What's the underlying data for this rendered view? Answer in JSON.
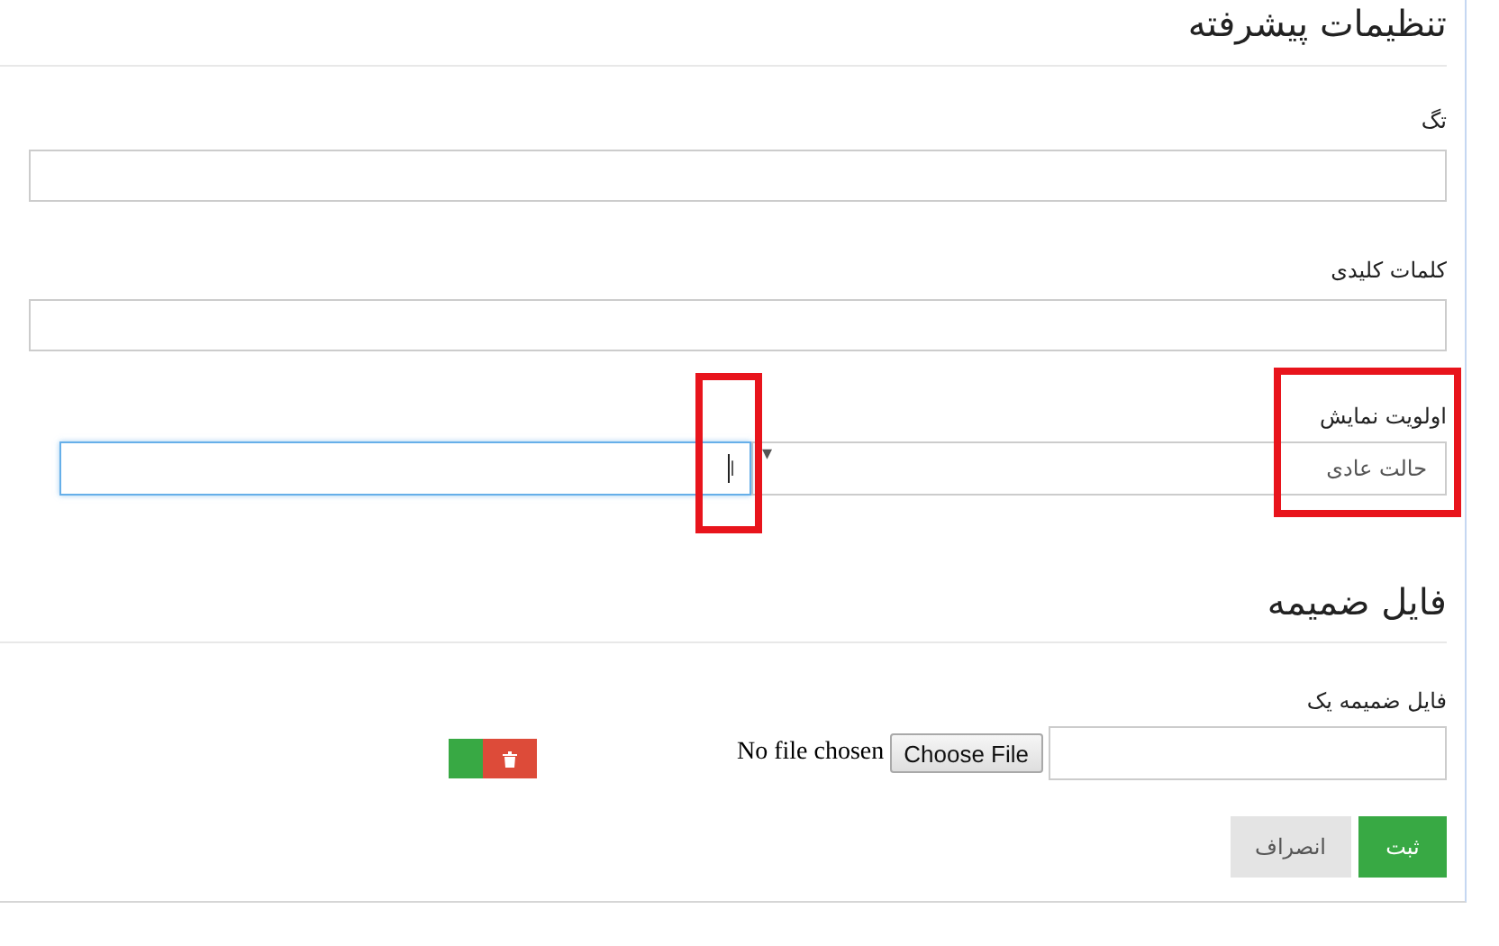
{
  "advanced_settings": {
    "title": "تنظیمات پیشرفته",
    "fields": [
      {
        "label": "تگ"
      },
      {
        "label": "کلمات کلیدی"
      }
    ],
    "priority": {
      "label": "اولویت نمایش",
      "value": "حالت عادی",
      "arrow": "▾",
      "search_value": "ا",
      "focused": true,
      "label_highlighted": true,
      "search_highlighted": true
    }
  },
  "attachments": {
    "title": "فایل ضمیمه",
    "file_row": {
      "label": "فایل ضمیمه یک",
      "choose_button": "Choose File",
      "status": "No file chosen"
    }
  },
  "buttons": [
    {
      "label": "ثبت",
      "kind": "primary"
    },
    {
      "label": "انصراف",
      "kind": "secondary"
    }
  ]
}
